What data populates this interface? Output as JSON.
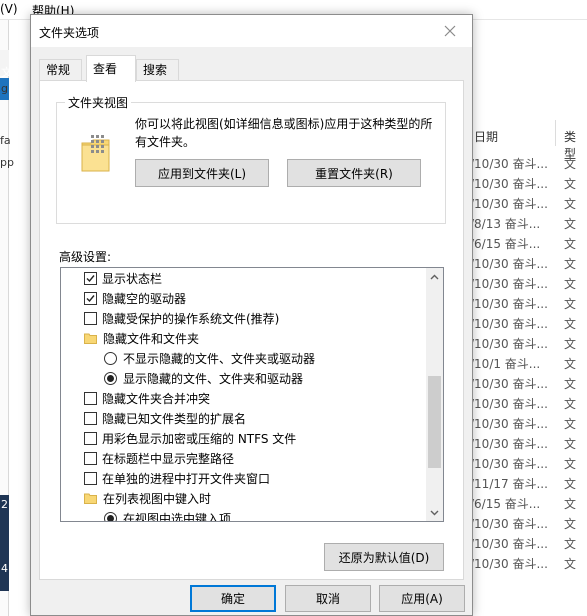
{
  "background": {
    "menu": [
      "(V)",
      "帮助(H)"
    ],
    "left_fragments": [
      "文",
      "g",
      "fa",
      "pp",
      "2",
      "4."
    ],
    "columns": {
      "date": "日期",
      "type": "类型"
    },
    "rows": [
      {
        "date": "/10/30 奋斗...",
        "type": "文"
      },
      {
        "date": "/10/30 奋斗...",
        "type": "文"
      },
      {
        "date": "/10/30 奋斗...",
        "type": "文"
      },
      {
        "date": "/8/13 奋斗...",
        "type": "文"
      },
      {
        "date": "/6/15 奋斗...",
        "type": "文"
      },
      {
        "date": "/10/30 奋斗...",
        "type": "文"
      },
      {
        "date": "/10/30 奋斗...",
        "type": "文"
      },
      {
        "date": "/10/30 奋斗...",
        "type": "文"
      },
      {
        "date": "/10/30 奋斗...",
        "type": "文"
      },
      {
        "date": "/10/30 奋斗...",
        "type": "文"
      },
      {
        "date": "/10/1 奋斗...",
        "type": "文"
      },
      {
        "date": "/10/30 奋斗...",
        "type": "文"
      },
      {
        "date": "/10/30 奋斗...",
        "type": "文"
      },
      {
        "date": "/10/30 奋斗...",
        "type": "文"
      },
      {
        "date": "/10/30 奋斗...",
        "type": "文"
      },
      {
        "date": "/10/30 奋斗...",
        "type": "文"
      },
      {
        "date": "/11/17 奋斗...",
        "type": "文"
      },
      {
        "date": "/6/15 奋斗...",
        "type": "文"
      },
      {
        "date": "/10/30 奋斗...",
        "type": "文"
      },
      {
        "date": "/10/30 奋斗...",
        "type": "文"
      },
      {
        "date": "/10/30 奋斗...",
        "type": "文"
      }
    ]
  },
  "dialog": {
    "title": "文件夹选项",
    "close_icon": "close-icon",
    "tabs": [
      {
        "label": "常规",
        "active": false
      },
      {
        "label": "查看",
        "active": true
      },
      {
        "label": "搜索",
        "active": false
      }
    ],
    "folder_views": {
      "title": "文件夹视图",
      "description": "你可以将此视图(如详细信息或图标)应用于这种类型的所有文件夹。",
      "apply_button": "应用到文件夹(L)",
      "reset_button": "重置文件夹(R)"
    },
    "advanced": {
      "label": "高级设置:",
      "items": [
        {
          "kind": "checkbox",
          "label": "显示状态栏",
          "checked": true,
          "indent": 1
        },
        {
          "kind": "checkbox",
          "label": "隐藏空的驱动器",
          "checked": true,
          "indent": 1
        },
        {
          "kind": "checkbox",
          "label": "隐藏受保护的操作系统文件(推荐)",
          "checked": false,
          "indent": 1
        },
        {
          "kind": "folder",
          "label": "隐藏文件和文件夹",
          "indent": 1
        },
        {
          "kind": "radio",
          "label": "不显示隐藏的文件、文件夹或驱动器",
          "checked": false,
          "indent": 2
        },
        {
          "kind": "radio",
          "label": "显示隐藏的文件、文件夹和驱动器",
          "checked": true,
          "indent": 2
        },
        {
          "kind": "checkbox",
          "label": "隐藏文件夹合并冲突",
          "checked": false,
          "indent": 1
        },
        {
          "kind": "checkbox",
          "label": "隐藏已知文件类型的扩展名",
          "checked": false,
          "indent": 1
        },
        {
          "kind": "checkbox",
          "label": "用彩色显示加密或压缩的 NTFS 文件",
          "checked": false,
          "indent": 1
        },
        {
          "kind": "checkbox",
          "label": "在标题栏中显示完整路径",
          "checked": false,
          "indent": 1
        },
        {
          "kind": "checkbox",
          "label": "在单独的进程中打开文件夹窗口",
          "checked": false,
          "indent": 1
        },
        {
          "kind": "folder",
          "label": "在列表视图中键入时",
          "indent": 1
        },
        {
          "kind": "radio",
          "label": "在视图中选中键入项",
          "checked": true,
          "indent": 2
        }
      ],
      "restore_button": "还原为默认值(D)"
    },
    "buttons": {
      "ok": "确定",
      "cancel": "取消",
      "apply": "应用(A)"
    },
    "colors": {
      "accent": "#0078d7",
      "folder": "#f8d775"
    }
  }
}
